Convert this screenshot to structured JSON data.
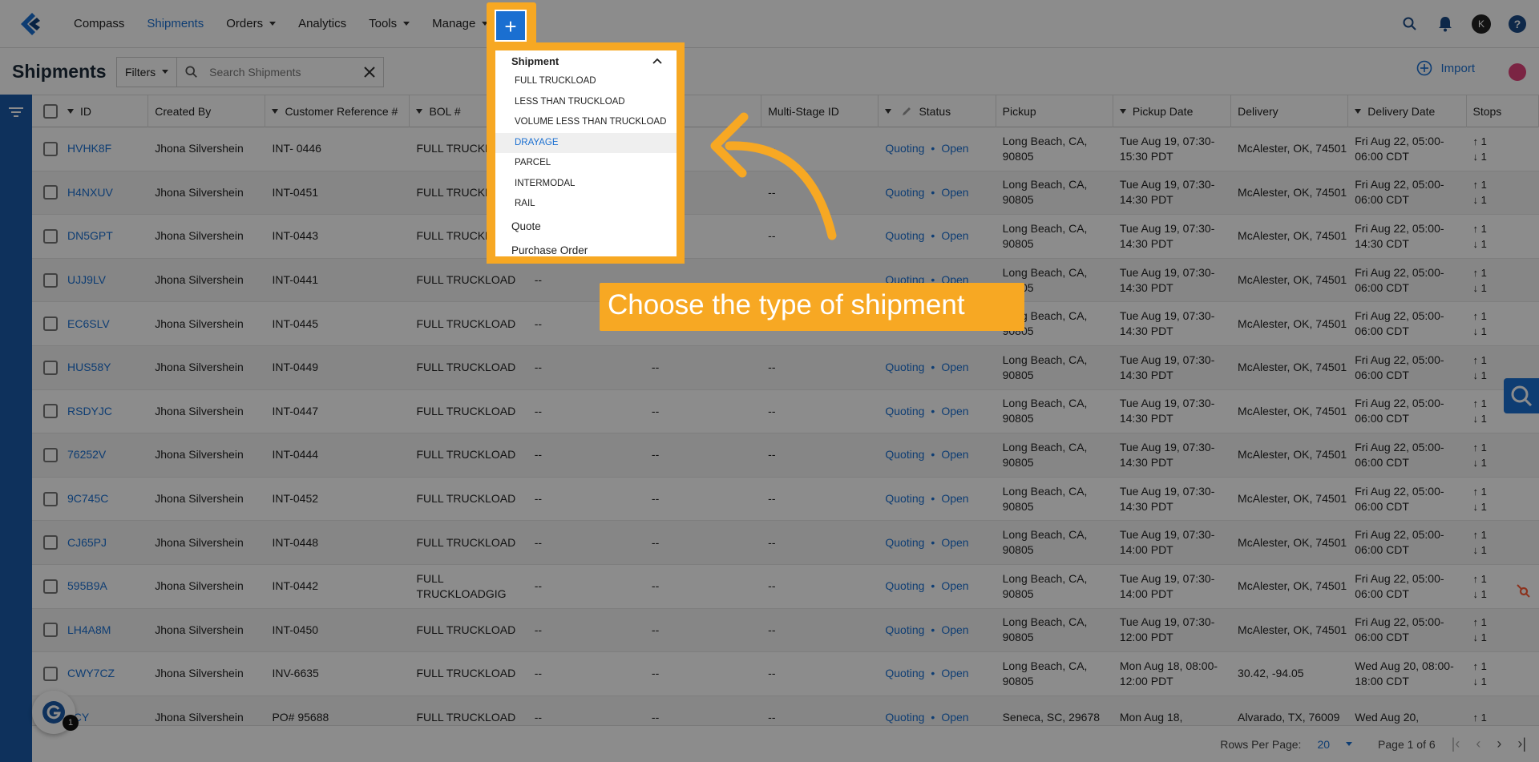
{
  "nav": {
    "items": [
      {
        "label": "Compass",
        "active": false,
        "dropdown": false
      },
      {
        "label": "Shipments",
        "active": true,
        "dropdown": false
      },
      {
        "label": "Orders",
        "active": false,
        "dropdown": true
      },
      {
        "label": "Analytics",
        "active": false,
        "dropdown": false
      },
      {
        "label": "Tools",
        "active": false,
        "dropdown": true
      },
      {
        "label": "Manage",
        "active": false,
        "dropdown": true
      }
    ],
    "plus_label": "+",
    "avatar_initial": "K",
    "help_label": "?"
  },
  "subheader": {
    "title": "Shipments",
    "filters_label": "Filters",
    "search_placeholder": "Search Shipments",
    "import_label": "Import"
  },
  "table": {
    "headers": [
      "ID",
      "Created By",
      "Customer Reference #",
      "BOL #",
      "",
      "",
      "Multi-Stage ID",
      "Status",
      "Pickup",
      "Pickup Date",
      "Delivery",
      "Delivery Date",
      "Stops"
    ],
    "header_partial": "s",
    "rows": [
      {
        "id": "HVHK8F",
        "created": "Jhona Silvershein",
        "ref": "INT- 0446",
        "bol": "FULL TRUCKLOAD",
        "c4": "",
        "c5": "",
        "multi": "--",
        "status_a": "Quoting",
        "status_b": "Open",
        "pickup": "Long Beach, CA, 90805",
        "pickup_date": "Tue Aug 19, 07:30-15:30 PDT",
        "delivery": "McAlester, OK, 74501",
        "delivery_date": "Fri Aug 22, 05:00-06:00 CDT",
        "stops_up": "↑ 1",
        "stops_down": "↓ 1"
      },
      {
        "id": "H4NXUV",
        "created": "Jhona Silvershein",
        "ref": "INT-0451",
        "bol": "FULL TRUCKLOAD",
        "c4": "",
        "c5": "",
        "multi": "--",
        "status_a": "Quoting",
        "status_b": "Open",
        "pickup": "Long Beach, CA, 90805",
        "pickup_date": "Tue Aug 19, 07:30-14:30 PDT",
        "delivery": "McAlester, OK, 74501",
        "delivery_date": "Fri Aug 22, 05:00-06:00 CDT",
        "stops_up": "↑ 1",
        "stops_down": "↓ 1"
      },
      {
        "id": "DN5GPT",
        "created": "Jhona Silvershein",
        "ref": "INT-0443",
        "bol": "FULL TRUCKLOAD",
        "c4": "",
        "c5": "",
        "multi": "--",
        "status_a": "Quoting",
        "status_b": "Open",
        "pickup": "Long Beach, CA, 90805",
        "pickup_date": "Tue Aug 19, 07:30-14:30 PDT",
        "delivery": "McAlester, OK, 74501",
        "delivery_date": "Fri Aug 22, 05:00-14:30 CDT",
        "stops_up": "↑ 1",
        "stops_down": "↓ 1"
      },
      {
        "id": "UJJ9LV",
        "created": "Jhona Silvershein",
        "ref": "INT-0441",
        "bol": "FULL TRUCKLOAD",
        "c4": "--",
        "c5": "",
        "multi": "",
        "status_a": "Quoting",
        "status_b": "Open",
        "pickup": "Long Beach, CA, 90805",
        "pickup_date": "Tue Aug 19, 07:30-14:30 PDT",
        "delivery": "McAlester, OK, 74501",
        "delivery_date": "Fri Aug 22, 05:00-06:00 CDT",
        "stops_up": "↑ 1",
        "stops_down": "↓ 1"
      },
      {
        "id": "EC6SLV",
        "created": "Jhona Silvershein",
        "ref": "INT-0445",
        "bol": "FULL TRUCKLOAD",
        "c4": "--",
        "c5": "",
        "multi": "",
        "status_a": "",
        "status_b": "",
        "pickup": "Long Beach, CA, 90805",
        "pickup_date": "Tue Aug 19, 07:30-14:30 PDT",
        "delivery": "McAlester, OK, 74501",
        "delivery_date": "Fri Aug 22, 05:00-06:00 CDT",
        "stops_up": "↑ 1",
        "stops_down": "↓ 1"
      },
      {
        "id": "HUS58Y",
        "created": "Jhona Silvershein",
        "ref": "INT-0449",
        "bol": "FULL TRUCKLOAD",
        "c4": "--",
        "c5": "--",
        "multi": "--",
        "status_a": "Quoting",
        "status_b": "Open",
        "pickup": "Long Beach, CA, 90805",
        "pickup_date": "Tue Aug 19, 07:30-14:30 PDT",
        "delivery": "McAlester, OK, 74501",
        "delivery_date": "Fri Aug 22, 05:00-06:00 CDT",
        "stops_up": "↑ 1",
        "stops_down": "↓ 1"
      },
      {
        "id": "RSDYJC",
        "created": "Jhona Silvershein",
        "ref": "INT-0447",
        "bol": "FULL TRUCKLOAD",
        "c4": "--",
        "c5": "--",
        "multi": "--",
        "status_a": "Quoting",
        "status_b": "Open",
        "pickup": "Long Beach, CA, 90805",
        "pickup_date": "Tue Aug 19, 07:30-14:30 PDT",
        "delivery": "McAlester, OK, 74501",
        "delivery_date": "Fri Aug 22, 05:00-06:00 CDT",
        "stops_up": "↑ 1",
        "stops_down": "↓ 1"
      },
      {
        "id": "76252V",
        "created": "Jhona Silvershein",
        "ref": "INT-0444",
        "bol": "FULL TRUCKLOAD",
        "c4": "--",
        "c5": "--",
        "multi": "--",
        "status_a": "Quoting",
        "status_b": "Open",
        "pickup": "Long Beach, CA, 90805",
        "pickup_date": "Tue Aug 19, 07:30-14:30 PDT",
        "delivery": "McAlester, OK, 74501",
        "delivery_date": "Fri Aug 22, 05:00-06:00 CDT",
        "stops_up": "↑ 1",
        "stops_down": "↓ 1"
      },
      {
        "id": "9C745C",
        "created": "Jhona Silvershein",
        "ref": "INT-0452",
        "bol": "FULL TRUCKLOAD",
        "c4": "--",
        "c5": "--",
        "multi": "--",
        "status_a": "Quoting",
        "status_b": "Open",
        "pickup": "Long Beach, CA, 90805",
        "pickup_date": "Tue Aug 19, 07:30-14:30 PDT",
        "delivery": "McAlester, OK, 74501",
        "delivery_date": "Fri Aug 22, 05:00-06:00 CDT",
        "stops_up": "↑ 1",
        "stops_down": "↓ 1"
      },
      {
        "id": "CJ65PJ",
        "created": "Jhona Silvershein",
        "ref": "INT-0448",
        "bol": "FULL TRUCKLOAD",
        "c4": "--",
        "c5": "--",
        "multi": "--",
        "status_a": "Quoting",
        "status_b": "Open",
        "pickup": "Long Beach, CA, 90805",
        "pickup_date": "Tue Aug 19, 07:30-14:00 PDT",
        "delivery": "McAlester, OK, 74501",
        "delivery_date": "Fri Aug 22, 05:00-06:00 CDT",
        "stops_up": "↑ 1",
        "stops_down": "↓ 1"
      },
      {
        "id": "595B9A",
        "created": "Jhona Silvershein",
        "ref": "INT-0442",
        "bol": "FULL TRUCKLOADGIG",
        "c4": "--",
        "c5": "--",
        "multi": "--",
        "status_a": "Quoting",
        "status_b": "Open",
        "pickup": "Long Beach, CA, 90805",
        "pickup_date": "Tue Aug 19, 07:30-14:00 PDT",
        "delivery": "McAlester, OK, 74501",
        "delivery_date": "Fri Aug 22, 05:00-06:00 CDT",
        "stops_up": "↑ 1",
        "stops_down": "↓ 1"
      },
      {
        "id": "LH4A8M",
        "created": "Jhona Silvershein",
        "ref": "INT-0450",
        "bol": "FULL TRUCKLOAD",
        "c4": "--",
        "c5": "--",
        "multi": "--",
        "status_a": "Quoting",
        "status_b": "Open",
        "pickup": "Long Beach, CA, 90805",
        "pickup_date": "Tue Aug 19, 07:30-12:00 PDT",
        "delivery": "McAlester, OK, 74501",
        "delivery_date": "Fri Aug 22, 05:00-06:00 CDT",
        "stops_up": "↑ 1",
        "stops_down": "↓ 1"
      },
      {
        "id": "CWY7CZ",
        "created": "Jhona Silvershein",
        "ref": "INV-6635",
        "bol": "FULL TRUCKLOAD",
        "c4": "--",
        "c5": "--",
        "multi": "--",
        "status_a": "Quoting",
        "status_b": "Open",
        "pickup": "Long Beach, CA, 90805",
        "pickup_date": "Mon Aug 18, 08:00-12:00 PDT",
        "delivery": "30.42, -94.05",
        "delivery_date": "Wed Aug 20, 08:00-18:00 CDT",
        "stops_up": "↑ 1",
        "stops_down": "↓ 1"
      },
      {
        "id": "8CY",
        "created": "Jhona Silvershein",
        "ref": "PO# 95688",
        "bol": "FULL TRUCKLOAD",
        "c4": "--",
        "c5": "--",
        "multi": "--",
        "status_a": "Quoting",
        "status_b": "Open",
        "pickup": "Seneca, SC, 29678",
        "pickup_date": "Mon Aug 18,",
        "delivery": "Alvarado, TX, 76009",
        "delivery_date": "Wed Aug 20,",
        "stops_up": "↑ 1",
        "stops_down": ""
      }
    ]
  },
  "footer": {
    "rows_per_page_label": "Rows Per Page:",
    "rows_per_page_value": "20",
    "page_label": "Page 1 of 6"
  },
  "dropdown": {
    "section_title": "Shipment",
    "items": [
      "FULL TRUCKLOAD",
      "LESS THAN TRUCKLOAD",
      "VOLUME LESS THAN TRUCKLOAD",
      "DRAYAGE",
      "PARCEL",
      "INTERMODAL",
      "RAIL"
    ],
    "highlighted": "DRAYAGE",
    "other_sections": [
      "Quote",
      "Purchase Order"
    ]
  },
  "callout": {
    "text": "Choose the type of shipment"
  },
  "badge": {
    "count": "1"
  },
  "colors": {
    "accent": "#1a6fd1",
    "highlight": "#f7a823",
    "rail": "#1a5aa8"
  }
}
